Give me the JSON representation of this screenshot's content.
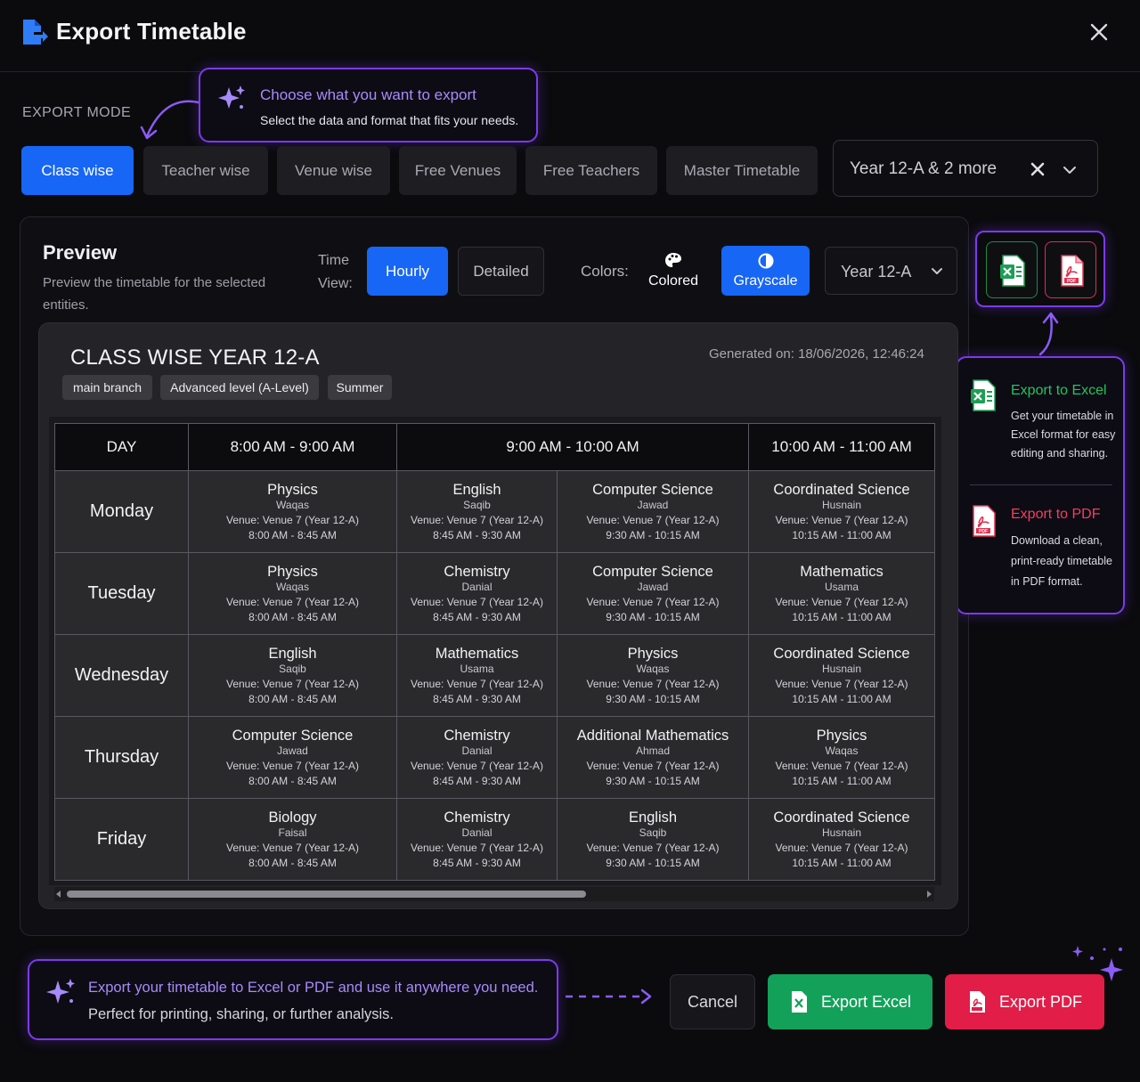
{
  "header": {
    "title": "Export Timetable",
    "logo_icon": "file-export-icon",
    "close_icon": "close-icon"
  },
  "export_mode": {
    "label": "EXPORT MODE",
    "tabs": [
      "Class wise",
      "Teacher wise",
      "Venue wise",
      "Free Venues",
      "Free Teachers",
      "Master Timetable"
    ],
    "active_tab": "Class wise",
    "entity_select": "Year 12-A & 2 more"
  },
  "callout_top": {
    "title": "Choose what you want to export",
    "subtitle": "Select the data and format that fits your needs."
  },
  "preview": {
    "title": "Preview",
    "subtitle": "Preview the timetable for the selected entities.",
    "time_view_label_line1": "Time",
    "time_view_label_line2": "View:",
    "time_view_options": [
      "Hourly",
      "Detailed"
    ],
    "colors_label": "Colors:",
    "color_options": [
      "Colored",
      "Grayscale"
    ],
    "year_select": "Year 12-A"
  },
  "side_card": {
    "excel_title": "Export to Excel",
    "excel_desc": "Get your timetable in Excel format for easy editing and sharing.",
    "pdf_title": "Export to PDF",
    "pdf_desc": "Download a clean, print-ready timetable in PDF format."
  },
  "timetable": {
    "title": "CLASS WISE YEAR 12-A",
    "generated": "Generated on: 18/06/2026, 12:46:24",
    "tags": [
      "main branch",
      "Advanced level (A-Level)",
      "Summer"
    ],
    "headers": [
      "DAY",
      "8:00 AM - 9:00 AM",
      "9:00 AM - 10:00 AM",
      "10:00 AM - 11:00 AM"
    ],
    "rows": [
      {
        "day": "Monday",
        "cells": [
          {
            "subject": "Physics",
            "teacher": "Waqas",
            "venue": "Venue: Venue 7 (Year 12-A)",
            "time": "8:00 AM - 8:45 AM"
          },
          {
            "subject": "English",
            "teacher": "Saqib",
            "venue": "Venue: Venue 7 (Year 12-A)",
            "time": "8:45 AM - 9:30 AM"
          },
          {
            "subject": "Computer Science",
            "teacher": "Jawad",
            "venue": "Venue: Venue 7 (Year 12-A)",
            "time": "9:30 AM - 10:15 AM"
          },
          {
            "subject": "Coordinated Science",
            "teacher": "Husnain",
            "venue": "Venue: Venue 7 (Year 12-A)",
            "time": "10:15 AM - 11:00 AM"
          }
        ]
      },
      {
        "day": "Tuesday",
        "cells": [
          {
            "subject": "Physics",
            "teacher": "Waqas",
            "venue": "Venue: Venue 7 (Year 12-A)",
            "time": "8:00 AM - 8:45 AM"
          },
          {
            "subject": "Chemistry",
            "teacher": "Danial",
            "venue": "Venue: Venue 7 (Year 12-A)",
            "time": "8:45 AM - 9:30 AM"
          },
          {
            "subject": "Computer Science",
            "teacher": "Jawad",
            "venue": "Venue: Venue 7 (Year 12-A)",
            "time": "9:30 AM - 10:15 AM"
          },
          {
            "subject": "Mathematics",
            "teacher": "Usama",
            "venue": "Venue: Venue 7 (Year 12-A)",
            "time": "10:15 AM - 11:00 AM"
          }
        ]
      },
      {
        "day": "Wednesday",
        "cells": [
          {
            "subject": "English",
            "teacher": "Saqib",
            "venue": "Venue: Venue 7 (Year 12-A)",
            "time": "8:00 AM - 8:45 AM"
          },
          {
            "subject": "Mathematics",
            "teacher": "Usama",
            "venue": "Venue: Venue 7 (Year 12-A)",
            "time": "8:45 AM - 9:30 AM"
          },
          {
            "subject": "Physics",
            "teacher": "Waqas",
            "venue": "Venue: Venue 7 (Year 12-A)",
            "time": "9:30 AM - 10:15 AM"
          },
          {
            "subject": "Coordinated Science",
            "teacher": "Husnain",
            "venue": "Venue: Venue 7 (Year 12-A)",
            "time": "10:15 AM - 11:00 AM"
          }
        ]
      },
      {
        "day": "Thursday",
        "cells": [
          {
            "subject": "Computer Science",
            "teacher": "Jawad",
            "venue": "Venue: Venue 7 (Year 12-A)",
            "time": "8:00 AM - 8:45 AM"
          },
          {
            "subject": "Chemistry",
            "teacher": "Danial",
            "venue": "Venue: Venue 7 (Year 12-A)",
            "time": "8:45 AM - 9:30 AM"
          },
          {
            "subject": "Additional Mathematics",
            "teacher": "Ahmad",
            "venue": "Venue: Venue 7 (Year 12-A)",
            "time": "9:30 AM - 10:15 AM"
          },
          {
            "subject": "Physics",
            "teacher": "Waqas",
            "venue": "Venue: Venue 7 (Year 12-A)",
            "time": "10:15 AM - 11:00 AM"
          }
        ]
      },
      {
        "day": "Friday",
        "cells": [
          {
            "subject": "Biology",
            "teacher": "Faisal",
            "venue": "Venue: Venue 7 (Year 12-A)",
            "time": "8:00 AM - 8:45 AM"
          },
          {
            "subject": "Chemistry",
            "teacher": "Danial",
            "venue": "Venue: Venue 7 (Year 12-A)",
            "time": "8:45 AM - 9:30 AM"
          },
          {
            "subject": "English",
            "teacher": "Saqib",
            "venue": "Venue: Venue 7 (Year 12-A)",
            "time": "9:30 AM - 10:15 AM"
          },
          {
            "subject": "Coordinated Science",
            "teacher": "Husnain",
            "venue": "Venue: Venue 7 (Year 12-A)",
            "time": "10:15 AM - 11:00 AM"
          }
        ]
      }
    ]
  },
  "callout_bottom": {
    "title": "Export your timetable to Excel or PDF and use it anywhere you need.",
    "subtitle": "Perfect for printing, sharing, or further analysis."
  },
  "footer": {
    "cancel": "Cancel",
    "export_excel": "Export Excel",
    "export_pdf": "Export PDF"
  },
  "colors": {
    "accent_blue": "#1766f5",
    "accent_purple": "#7c3aed",
    "excel_green": "#13a15a",
    "pdf_red": "#e11d48"
  }
}
